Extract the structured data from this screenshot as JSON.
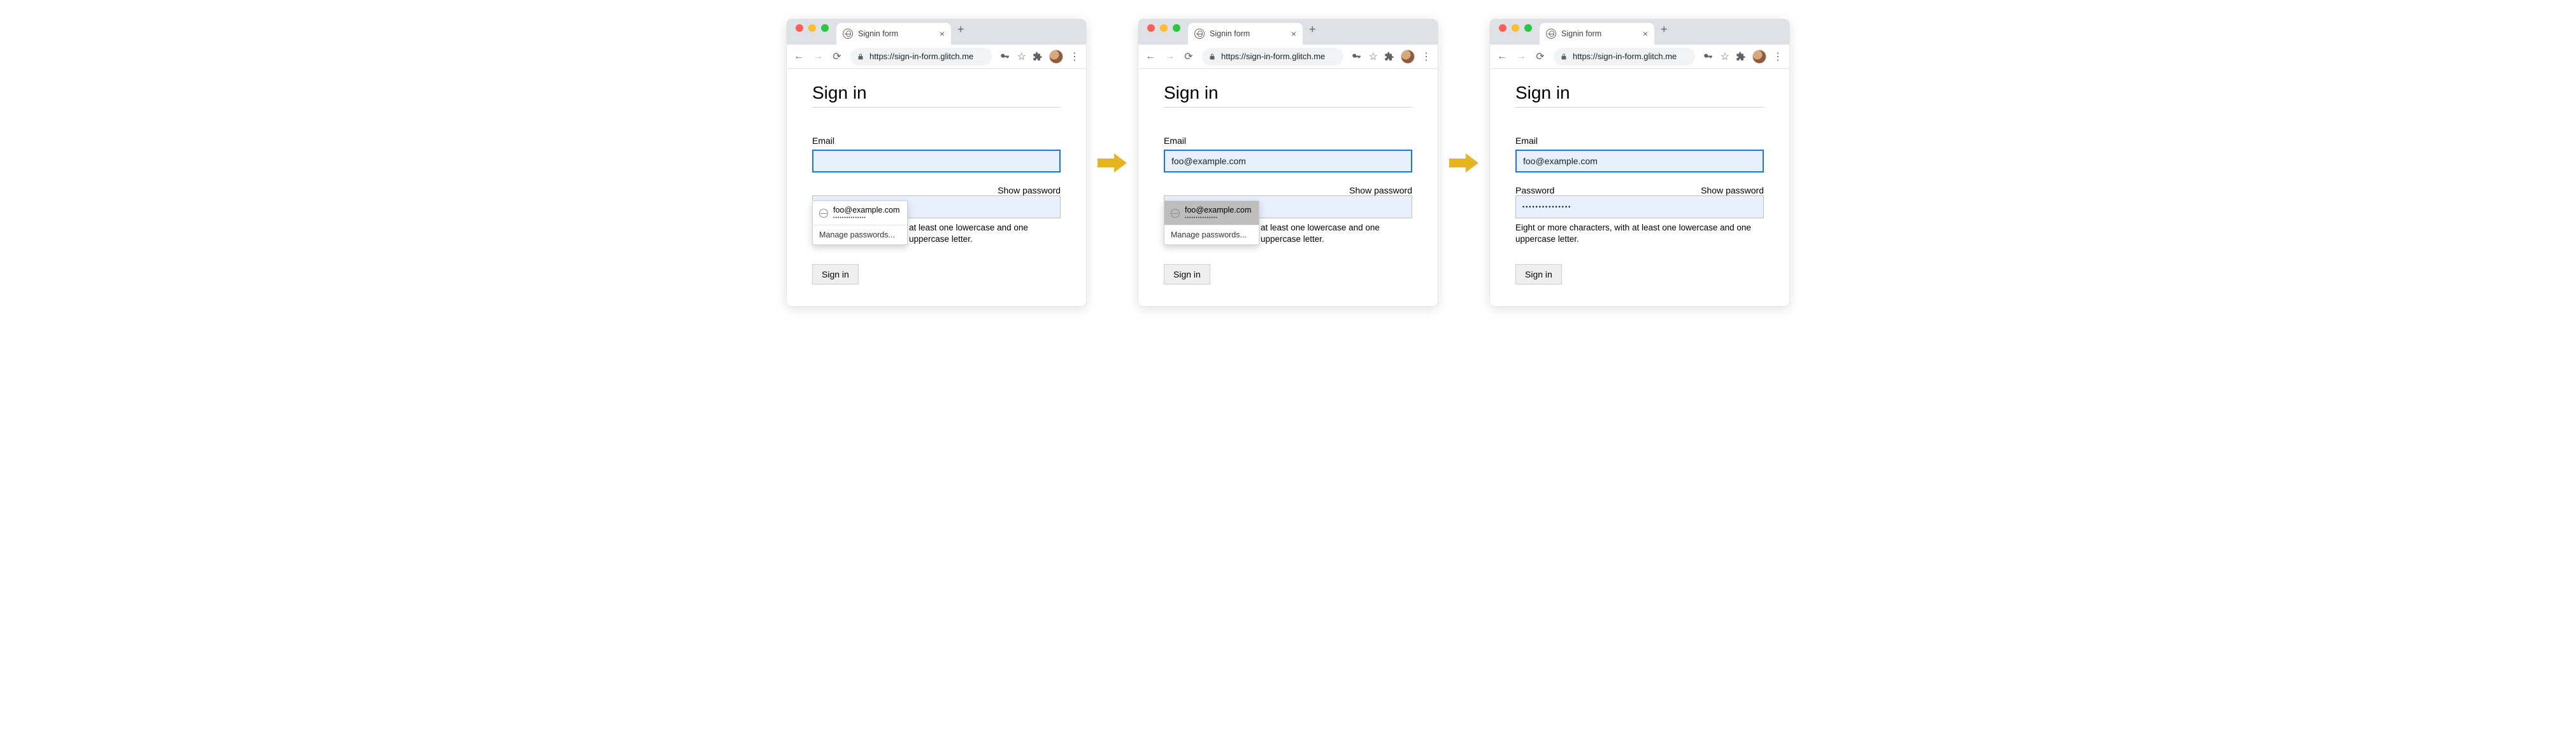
{
  "browser": {
    "tab_title": "Signin form",
    "url": "https://sign-in-form.glitch.me"
  },
  "page": {
    "heading": "Sign in",
    "email_label": "Email",
    "password_label": "Password",
    "show_password": "Show password",
    "hint": "Eight or more characters, with at least one lowercase and one uppercase letter.",
    "submit": "Sign in"
  },
  "autofill": {
    "email": "foo@example.com",
    "password_mask": "•••••••••••••••",
    "manage": "Manage passwords..."
  }
}
